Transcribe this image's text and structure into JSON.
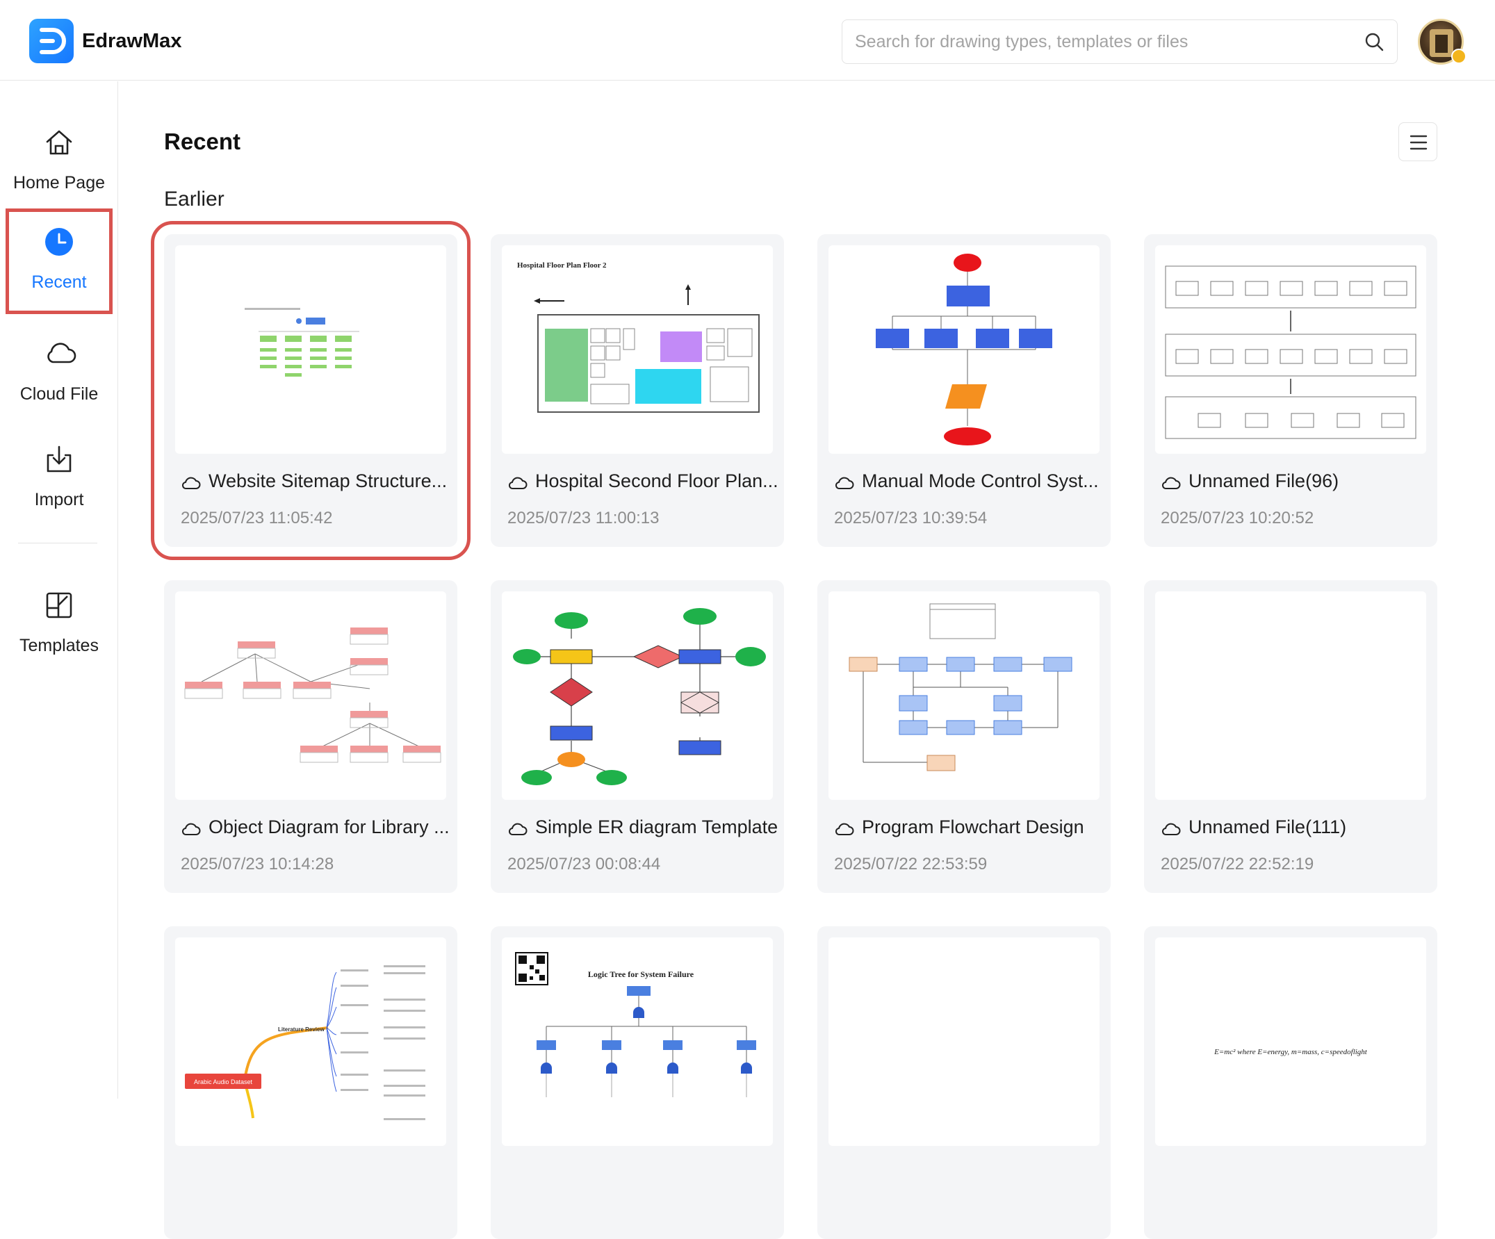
{
  "app": {
    "name": "EdrawMax"
  },
  "search": {
    "placeholder": "Search for drawing types, templates or files"
  },
  "sidebar": {
    "items": [
      {
        "label": "Home Page",
        "icon": "home-icon"
      },
      {
        "label": "Recent",
        "icon": "clock-icon",
        "active": true
      },
      {
        "label": "Cloud File",
        "icon": "cloud-icon"
      },
      {
        "label": "Import",
        "icon": "import-icon"
      },
      {
        "label": "Templates",
        "icon": "templates-icon"
      }
    ]
  },
  "main": {
    "title": "Recent",
    "section": "Earlier",
    "files": [
      {
        "title": "Website Sitemap Structure...",
        "date": "2025/07/23 11:05:42"
      },
      {
        "title": "Hospital Second Floor Plan...",
        "date": "2025/07/23 11:00:13"
      },
      {
        "title": "Manual Mode Control Syst...",
        "date": "2025/07/23 10:39:54"
      },
      {
        "title": "Unnamed File(96)",
        "date": "2025/07/23 10:20:52"
      },
      {
        "title": "Object Diagram for Library ...",
        "date": "2025/07/23 10:14:28"
      },
      {
        "title": "Simple ER diagram Template",
        "date": "2025/07/23 00:08:44"
      },
      {
        "title": "Program Flowchart Design",
        "date": "2025/07/22 22:53:59"
      },
      {
        "title": "Unnamed File(111)",
        "date": "2025/07/22 22:52:19"
      }
    ],
    "thumb_text": {
      "hospital": "Hospital Floor Plan Floor 2",
      "logic": "Logic Tree for System Failure",
      "lit": "Literature Review",
      "dataset": "Arabic Audio Dataset",
      "formula": "E=mc² where E=energy, m=mass, c=speedoflight"
    }
  },
  "colors": {
    "accent": "#1677ff",
    "highlight": "#d9534f"
  }
}
